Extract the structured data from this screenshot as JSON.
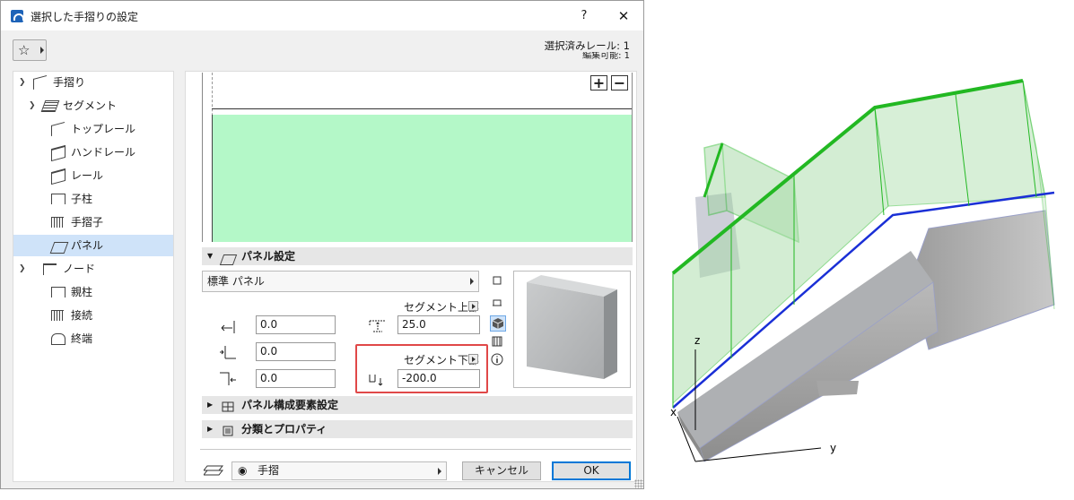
{
  "window": {
    "title": "選択した手摺りの設定",
    "help": "?",
    "close": "✕"
  },
  "selection": {
    "line1": "選択済みレール: 1",
    "line2": "編集可能: 1"
  },
  "tree": [
    {
      "label": "手摺り",
      "icon": "railing-icon",
      "expanded": true
    },
    {
      "label": "セグメント",
      "icon": "segment-icon",
      "expanded": true
    },
    {
      "label": "トップレール",
      "icon": "top-rail-icon"
    },
    {
      "label": "ハンドレール",
      "icon": "handrail-icon"
    },
    {
      "label": "レール",
      "icon": "rail-icon"
    },
    {
      "label": "子柱",
      "icon": "baluster-post-icon"
    },
    {
      "label": "手摺子",
      "icon": "baluster-icon"
    },
    {
      "label": "パネル",
      "icon": "panel-icon",
      "selected": true
    },
    {
      "label": "ノード",
      "icon": "node-icon",
      "expanded": true
    },
    {
      "label": "親柱",
      "icon": "newel-post-icon"
    },
    {
      "label": "接続",
      "icon": "connection-icon"
    },
    {
      "label": "終端",
      "icon": "end-icon"
    }
  ],
  "panel_settings": {
    "title": "パネル設定",
    "type_dropdown": "標準 パネル",
    "fields_left": [
      "0.0",
      "0.0",
      "0.0"
    ],
    "segment_top_label": "セグメント上部",
    "segment_top_value": "25.0",
    "segment_bottom_label": "セグメント下部",
    "segment_bottom_value": "-200.0"
  },
  "sections": {
    "components": "パネル構成要素設定",
    "classification": "分類とプロパティ"
  },
  "footer": {
    "layer": "手摺",
    "cancel": "キャンセル",
    "ok": "OK"
  },
  "view3d": {
    "axis_z": "z",
    "axis_x": "x",
    "axis_y": "y"
  },
  "colors": {
    "panel_preview_fill": "#b4f8c8",
    "selection_blue": "#cfe3f9",
    "highlight_red": "#e04848",
    "rail_green": "#22b822",
    "rail_blue": "#1a2fd6"
  }
}
